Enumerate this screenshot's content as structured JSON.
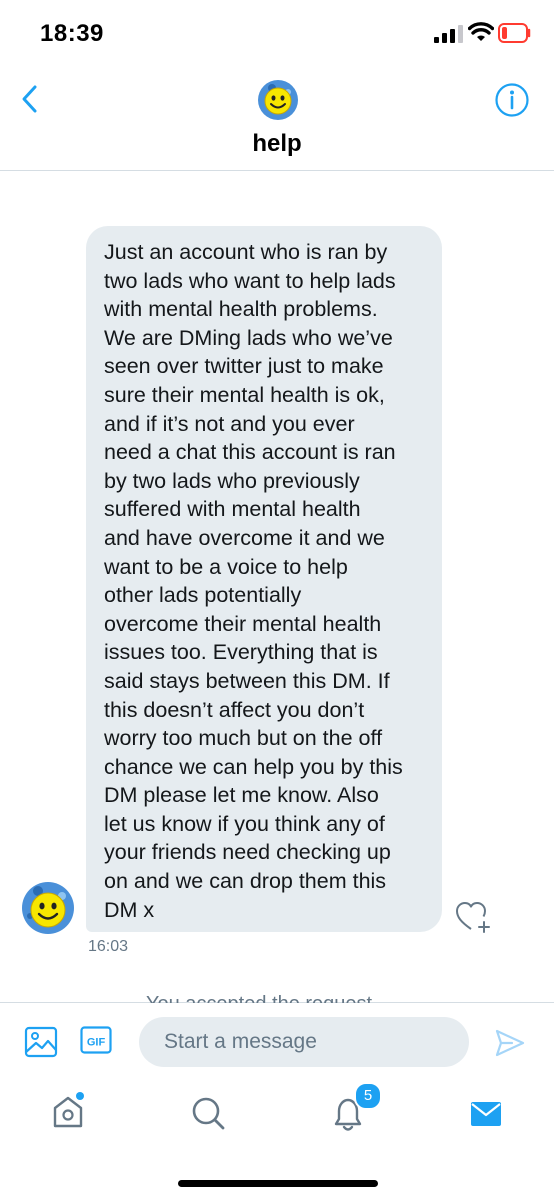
{
  "status_bar": {
    "time": "18:39"
  },
  "header": {
    "title": "help"
  },
  "message": {
    "text": "Just an account who is ran by\ntwo lads who want to help lads\nwith mental health problems.\nWe are DMing lads who we’ve\nseen over twitter just to make\nsure their mental health is ok,\nand if it’s not and you ever\nneed a chat this account is ran\nby two lads who previously\nsuffered with mental health\nand have overcome it and we\nwant to be a voice to help\nother lads potentially\novercome their mental health\nissues too. Everything that is\nsaid stays between this DM. If\nthis doesn’t affect you don’t\nworry too much but on the off\nchance we can help you by this\nDM please let me know. Also\nlet us know if you think any of\nyour friends need checking up\non and we can drop them this\nDM x",
    "time": "16:03"
  },
  "composer": {
    "placeholder": "Start a message",
    "gif_label": "GIF",
    "cut_off_text": "You accepted the request"
  },
  "tabbar": {
    "notifications_count": "5"
  },
  "colors": {
    "accent": "#1da1f2",
    "bubble": "#e6ecf0",
    "muted": "#657786"
  }
}
